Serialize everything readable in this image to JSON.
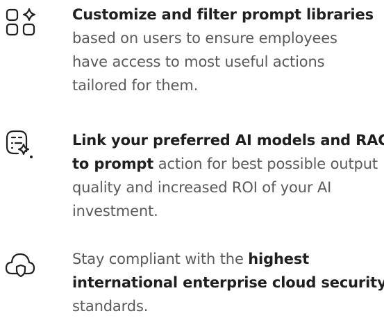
{
  "features": [
    {
      "icon": "grid-sparkle-icon",
      "lines": [
        [
          {
            "text": "Customize and filter prompt libraries",
            "bold": true
          }
        ],
        [
          {
            "text": "based on users to ensure employees",
            "bold": false
          }
        ],
        [
          {
            "text": "have access to most useful actions",
            "bold": false
          }
        ],
        [
          {
            "text": "tailored for them.",
            "bold": false
          }
        ]
      ]
    },
    {
      "icon": "prompt-sparkle-icon",
      "lines": [
        [
          {
            "text": "Link your preferred AI models and RAG",
            "bold": true
          }
        ],
        [
          {
            "text": "to prompt",
            "bold": true
          },
          {
            "text": " action for best possible output",
            "bold": false
          }
        ],
        [
          {
            "text": "quality and increased ROI of your AI",
            "bold": false
          }
        ],
        [
          {
            "text": "investment.",
            "bold": false
          }
        ]
      ]
    },
    {
      "icon": "cloud-shield-icon",
      "lines": [
        [
          {
            "text": "Stay compliant with the ",
            "bold": false
          },
          {
            "text": "highest",
            "bold": true
          }
        ],
        [
          {
            "text": "international enterprise cloud security",
            "bold": true
          }
        ],
        [
          {
            "text": "standards.",
            "bold": false
          }
        ]
      ]
    }
  ]
}
